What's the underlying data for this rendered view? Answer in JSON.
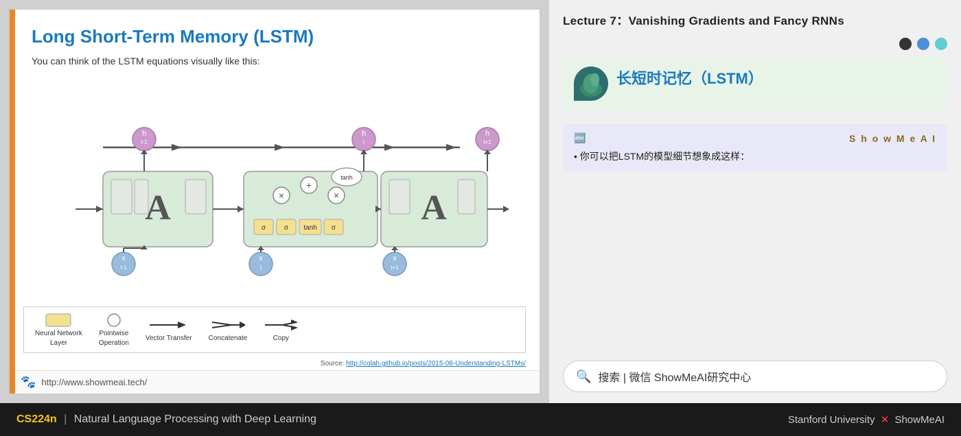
{
  "slide": {
    "title": "Long Short-Term Memory (LSTM)",
    "subtitle": "You can think of the LSTM equations visually like this:",
    "source_label": "Source:",
    "source_url": "http://colah.github.io/posts/2015-08-Understanding-LSTMs/",
    "footer_url": "http://www.showmeai.tech/",
    "legend": [
      {
        "label_line1": "Neural Network",
        "label_line2": "Layer",
        "type": "rect"
      },
      {
        "label_line1": "Pointwise",
        "label_line2": "Operation",
        "type": "circle"
      },
      {
        "label_line1": "Vector",
        "label_line2": "Transfer",
        "type": "arrow"
      },
      {
        "label_line1": "Concatenate",
        "label_line2": "",
        "type": "concat"
      },
      {
        "label_line1": "Copy",
        "label_line2": "",
        "type": "copy"
      }
    ]
  },
  "right": {
    "lecture_title": "Lecture 7：Vanishing Gradients and Fancy RNNs",
    "chinese_title": "长短时记忆（LSTM）",
    "info_logo": "S h o w M e A I",
    "info_bullet": "你可以把LSTM的模型细节想象成这样：",
    "search_text": "搜索 | 微信  ShowMeAI研究中心"
  },
  "bottom": {
    "cs_label": "CS224n",
    "pipe": "|",
    "description": "Natural Language Processing with Deep Learning",
    "right_text": "Stanford University",
    "x_symbol": "✕",
    "brand": "ShowMeAI"
  }
}
